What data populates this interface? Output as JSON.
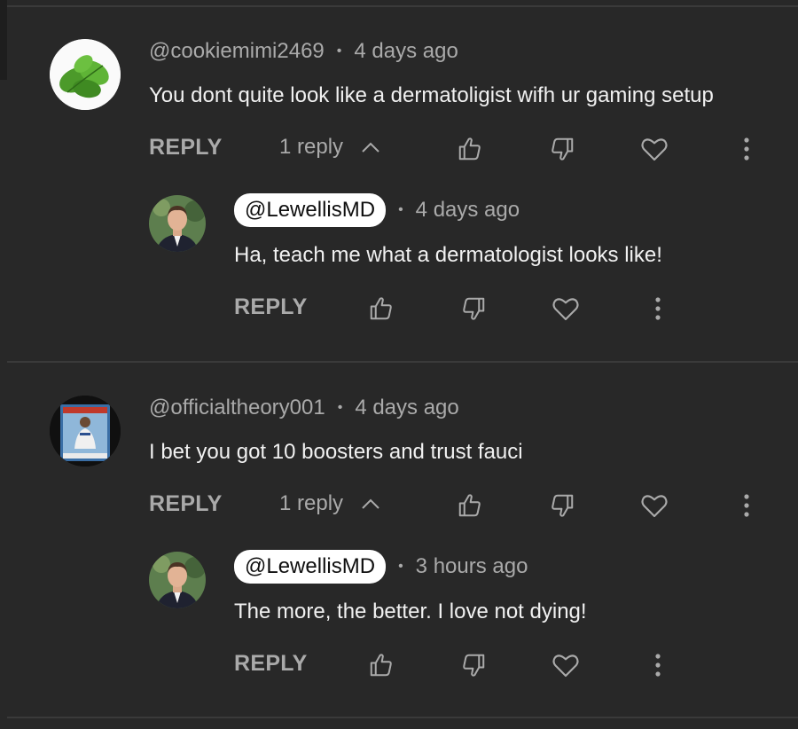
{
  "threads": [
    {
      "author": "@cookiemimi2469",
      "time": "4 days ago",
      "text": "You dont quite look like a dermatoligist wifh ur gaming setup",
      "reply_label": "REPLY",
      "replies_count": "1 reply",
      "avatar": "basil-leaf",
      "reply": {
        "author": "@LewellisMD",
        "time": "4 days ago",
        "text": "Ha, teach me what a dermatologist looks like!",
        "reply_label": "REPLY",
        "avatar": "man-in-suit"
      }
    },
    {
      "author": "@officialtheory001",
      "time": "4 days ago",
      "text": "I bet you got 10 boosters and trust fauci",
      "reply_label": "REPLY",
      "replies_count": "1 reply",
      "avatar": "baseball-card",
      "reply": {
        "author": "@LewellisMD",
        "time": "3 hours ago",
        "text": "The more, the better. I love not dying!",
        "reply_label": "REPLY",
        "avatar": "man-in-suit"
      }
    }
  ],
  "icons": {
    "like": "thumbs-up-icon",
    "dislike": "thumbs-down-icon",
    "heart": "heart-icon",
    "more": "more-vert-icon",
    "chevron": "chevron-up-icon"
  },
  "colors": {
    "background": "#282828",
    "text": "#f1f1f1",
    "secondary": "#aaaaaa",
    "pill": "#ffffff"
  }
}
